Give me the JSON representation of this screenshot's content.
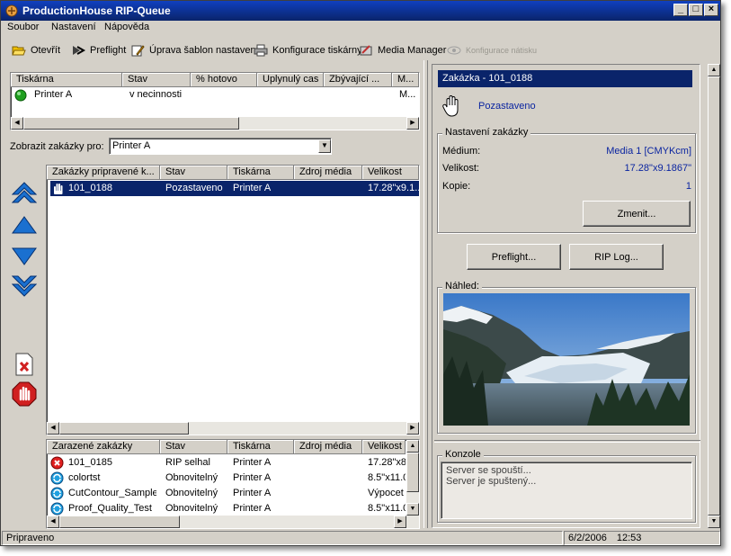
{
  "window": {
    "title": "ProductionHouse RIP-Queue"
  },
  "menu": {
    "file": "Soubor",
    "settings": "Nastavení",
    "help": "Nápověda"
  },
  "toolbar": {
    "open": "Otevřít",
    "preflight": "Preflight",
    "edit_templates": "Úprava šablon nastavení",
    "printer_config": "Konfigurace tiskárny",
    "media_manager": "Media Manager",
    "calibration_config": "Konfigurace nátisku"
  },
  "printers_table": {
    "headers": [
      "Tiskárna",
      "Stav",
      "% hotovo",
      "Uplynulý cas",
      "Zbývající ...",
      "M..."
    ],
    "rows": [
      {
        "name": "Printer A",
        "status": "v necinnosti",
        "last": "M..."
      }
    ]
  },
  "filter": {
    "label": "Zobrazit zakázky pro:",
    "selected": "Printer A"
  },
  "ready_jobs": {
    "headers": [
      "Zakázky pripravené k...",
      "Stav",
      "Tiskárna",
      "Zdroj média",
      "Velikost"
    ],
    "rows": [
      {
        "name": "101_0188",
        "status": "Pozastaveno",
        "printer": "Printer A",
        "media": "",
        "size": "17.28\"x9.1..."
      }
    ]
  },
  "queued_jobs": {
    "headers": [
      "Zarazené zakázky",
      "Stav",
      "Tiskárna",
      "Zdroj média",
      "Velikost"
    ],
    "rows": [
      {
        "icon": "error-icon",
        "name": "101_0185",
        "status": "RIP selhal",
        "printer": "Printer A",
        "media": "",
        "size": "17.28\"x8"
      },
      {
        "icon": "refresh-icon",
        "name": "colortst",
        "status": "Obnovitelný",
        "printer": "Printer A",
        "media": "",
        "size": "8.5\"x11.0"
      },
      {
        "icon": "refresh-icon",
        "name": "CutContour_Sample",
        "status": "Obnovitelný",
        "printer": "Printer A",
        "media": "",
        "size": "Výpocet"
      },
      {
        "icon": "refresh-icon",
        "name": "Proof_Quality_Test",
        "status": "Obnovitelný",
        "printer": "Printer A",
        "media": "",
        "size": "8.5\"x11.0"
      }
    ]
  },
  "job_panel": {
    "title": "Zakázka - 101_0188",
    "status": "Pozastaveno",
    "settings_legend": "Nastavení zakázky",
    "medium_label": "Médium:",
    "medium_value": "Media 1 [CMYKcm]",
    "size_label": "Velikost:",
    "size_value": "17.28\"x9.1867\"",
    "copies_label": "Kopie:",
    "copies_value": "1",
    "change_button": "Zmenit...",
    "preflight_button": "Preflight...",
    "riplog_button": "RIP Log...",
    "preview_legend": "Náhled:"
  },
  "console": {
    "legend": "Konzole",
    "lines": [
      "Server se spouští...",
      "Server je spuštený..."
    ]
  },
  "status": {
    "text": "Pripraveno",
    "date": "6/2/2006",
    "time": "12:53"
  },
  "colors": {
    "titlebar": "#0a246a",
    "selection": "#0a246a",
    "value_text": "#0a24a0",
    "face": "#d4d0c8"
  }
}
